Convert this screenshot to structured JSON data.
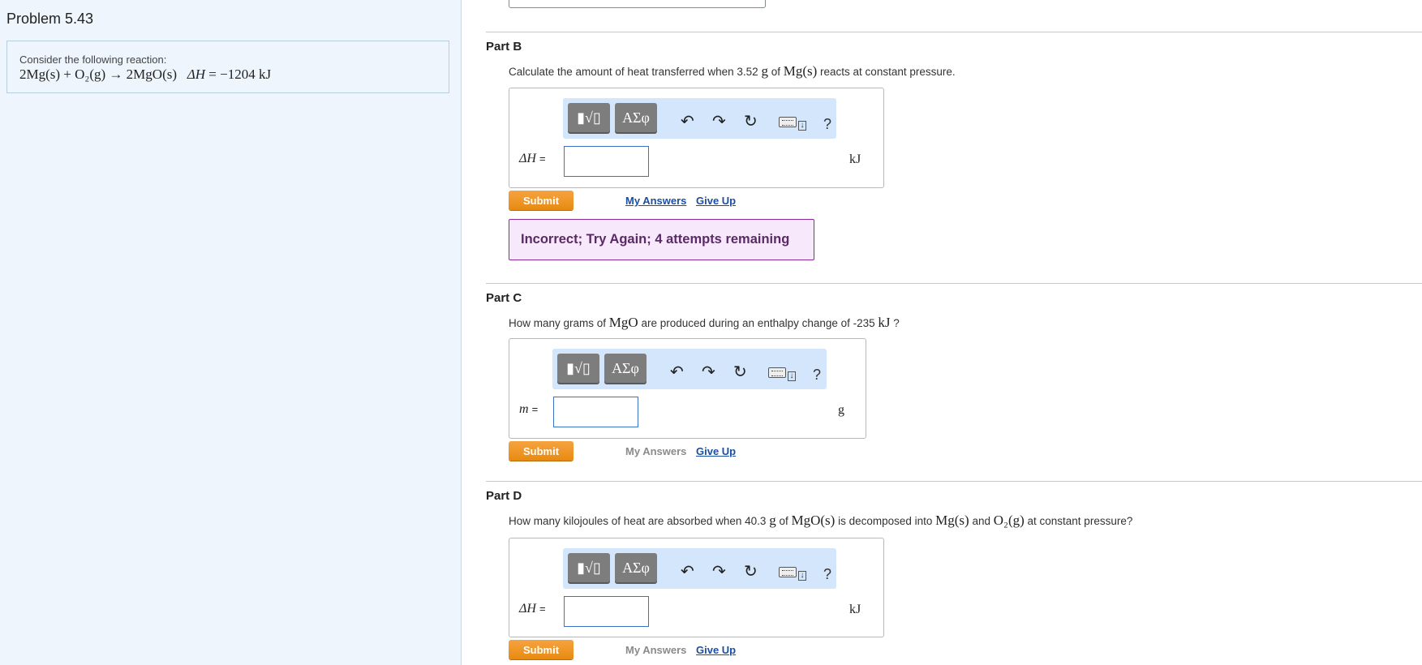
{
  "problem": {
    "title": "Problem 5.43",
    "intro": "Consider the following reaction:",
    "reaction": {
      "lhs": "2Mg(s) + O₂(g)",
      "arrow": "→",
      "rhs": "2MgO(s)",
      "dh_label": "ΔH",
      "dh_value": "= −1204 kJ"
    }
  },
  "toolbar": {
    "sqrt_label": "▮√▯",
    "symbols_label": "ΑΣφ",
    "undo_glyph": "↶",
    "redo_glyph": "↷",
    "reset_glyph": "↻",
    "help_label": "?"
  },
  "parts": {
    "b": {
      "title": "Part B",
      "q_pre": "Calculate the amount of heat transferred when 3.52 ",
      "q_unit": "g",
      "q_mid": " of ",
      "q_species": "Mg(s)",
      "q_post": " reacts at constant pressure.",
      "var": "ΔH",
      "eq": "=",
      "value": "",
      "unit": "kJ",
      "submit": "Submit",
      "my_answers": "My Answers",
      "give_up": "Give Up",
      "feedback": "Incorrect; Try Again; 4 attempts remaining"
    },
    "c": {
      "title": "Part C",
      "q_pre": "How many grams of ",
      "q_species": "MgO",
      "q_mid": " are produced during an enthalpy change of -235 ",
      "q_unit": "kJ",
      "q_post": " ?",
      "var": "m",
      "eq": "=",
      "value": "",
      "unit": "g",
      "submit": "Submit",
      "my_answers": "My Answers",
      "give_up": "Give Up"
    },
    "d": {
      "title": "Part D",
      "q_pre": "How many kilojoules of heat are absorbed when 40.3 ",
      "q_unit": "g",
      "q_mid": " of ",
      "q_species": "MgO(s)",
      "q_mid2": " is decomposed into ",
      "q_species2": "Mg(s)",
      "q_and": " and ",
      "q_species3": "O₂(g)",
      "q_post": " at constant pressure?",
      "var": "ΔH",
      "eq": "=",
      "value": "",
      "unit": "kJ",
      "submit": "Submit",
      "my_answers": "My Answers",
      "give_up": "Give Up"
    }
  }
}
